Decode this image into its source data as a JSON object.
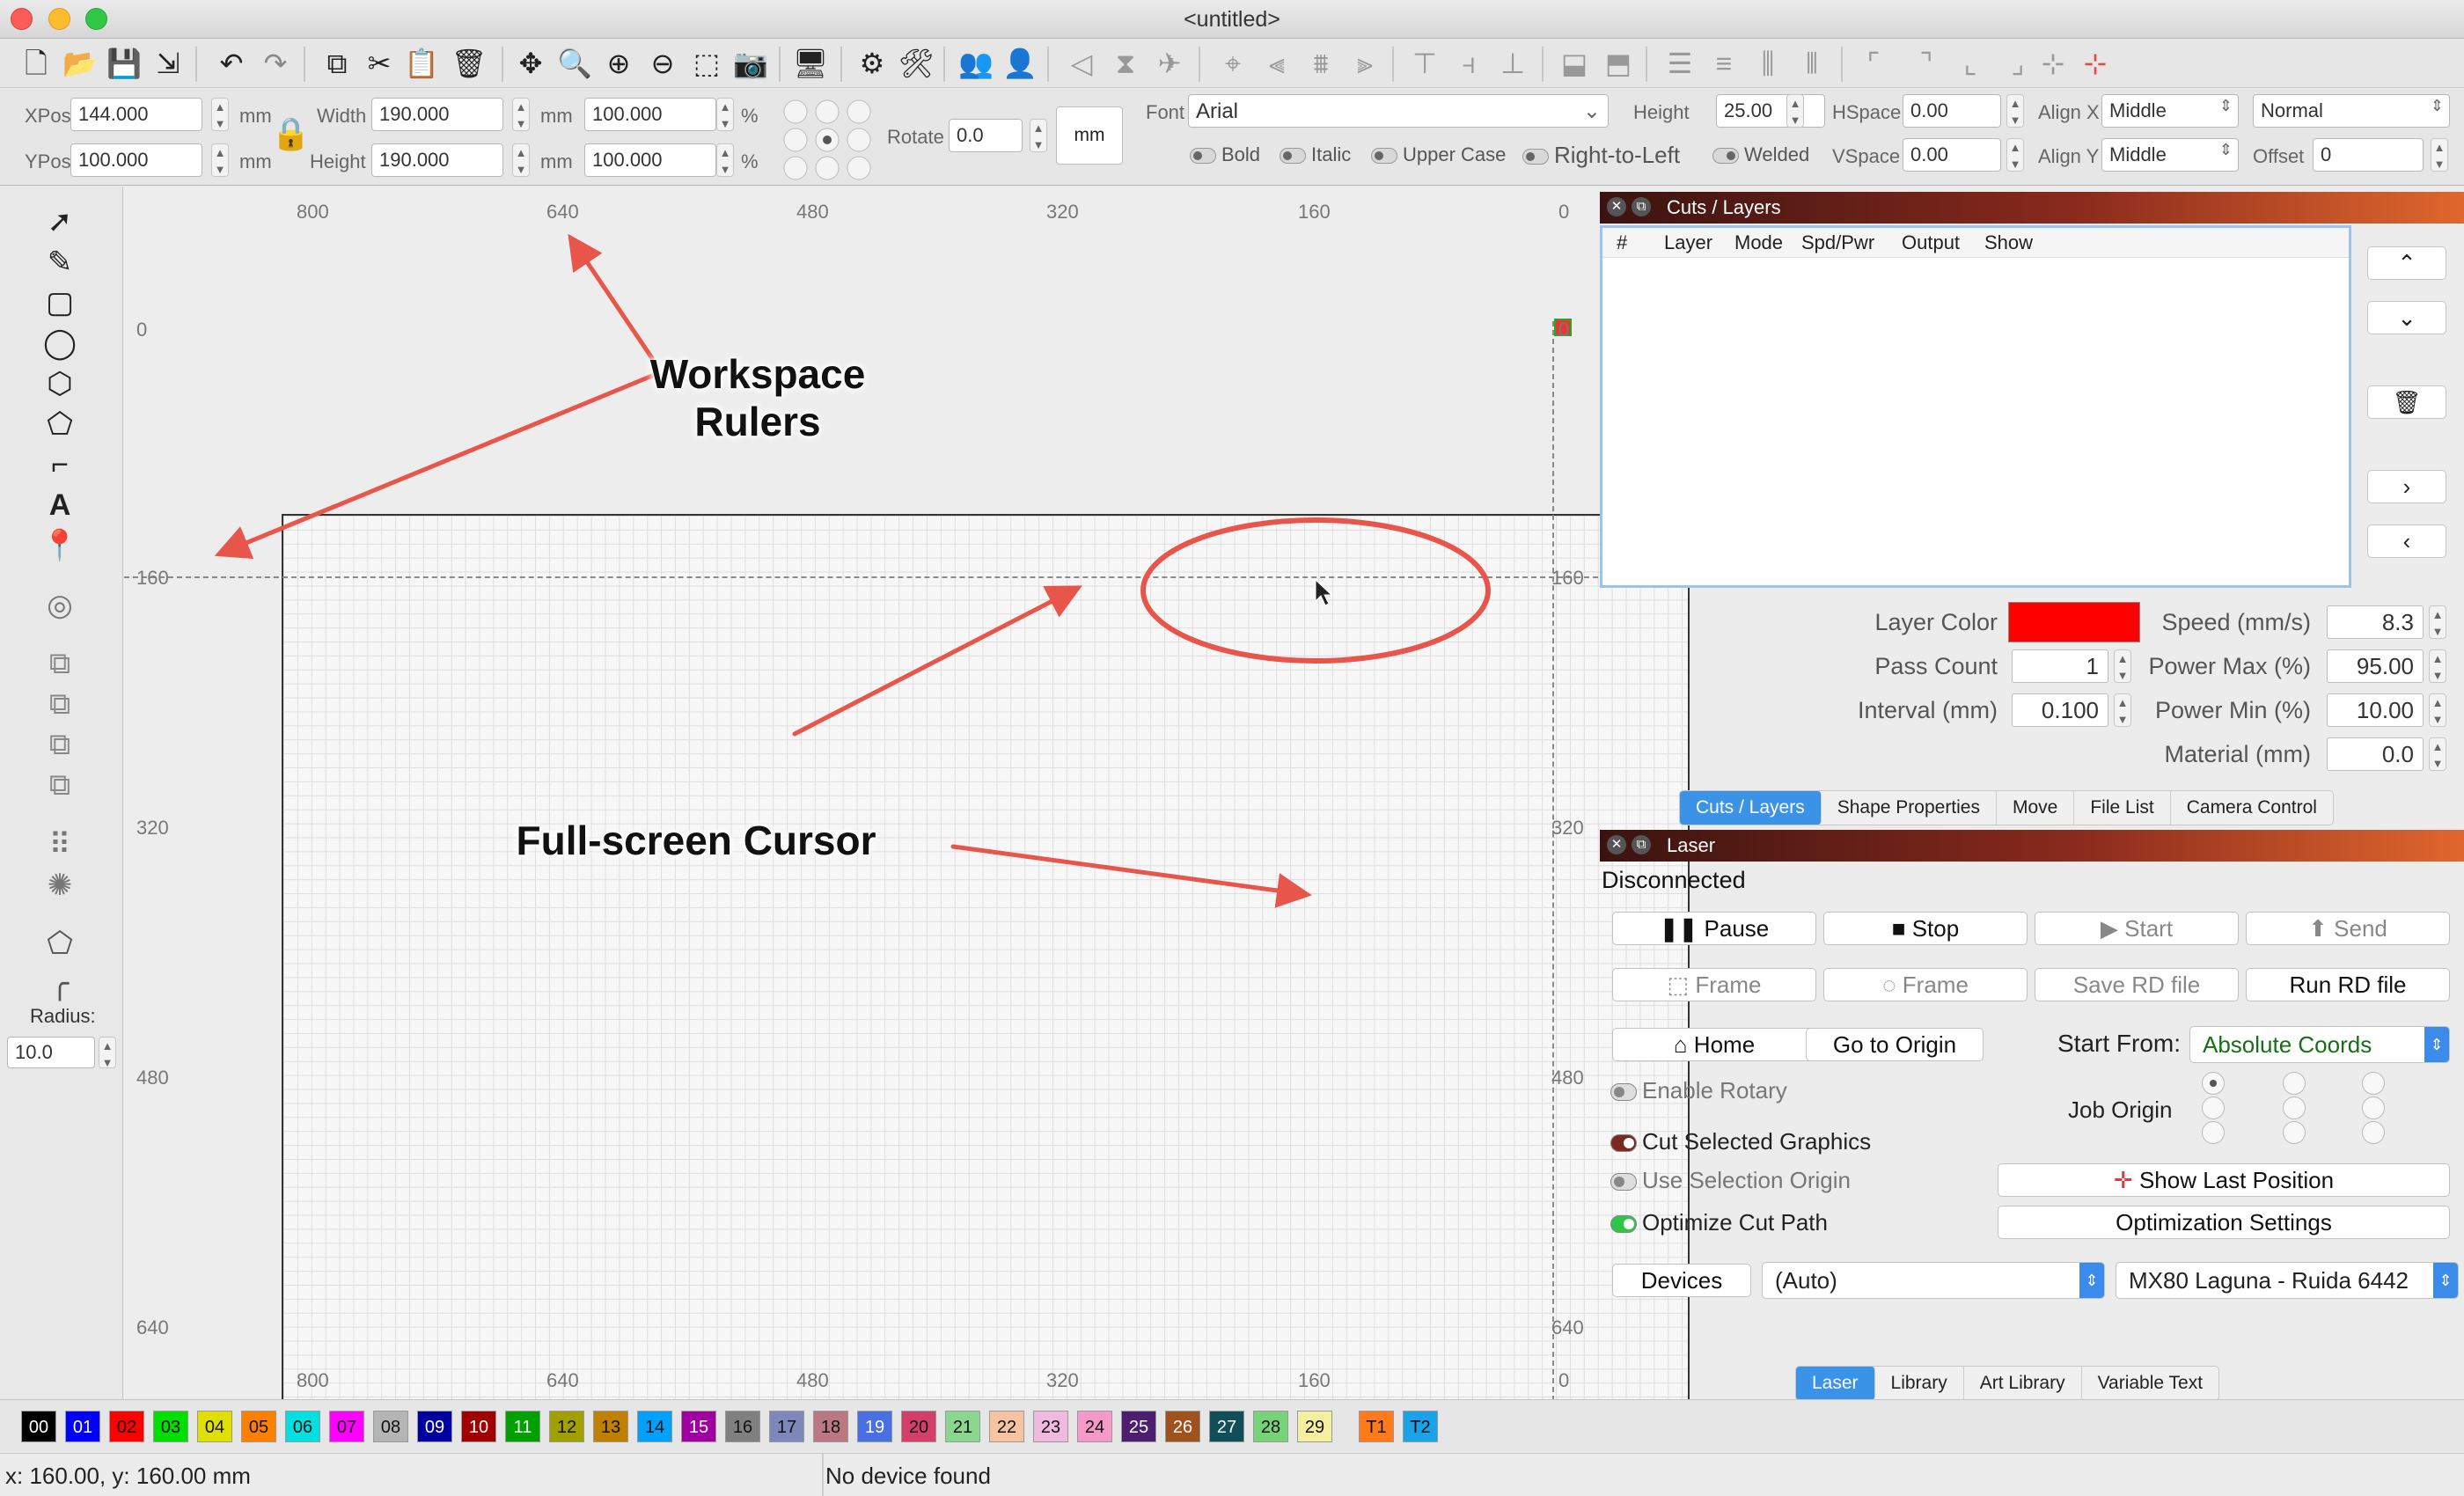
{
  "window": {
    "title": "<untitled>"
  },
  "toolbar2": {
    "xpos_label": "XPos",
    "xpos_value": "144.000",
    "ypos_label": "YPos",
    "ypos_value": "100.000",
    "unit": "mm",
    "width_label": "Width",
    "width_value": "190.000",
    "height_label": "Height",
    "height_value": "190.000",
    "scale_w": "100.000",
    "scale_h": "100.000",
    "percent": "%",
    "rotate_label": "Rotate",
    "rotate_value": "0.0",
    "units_button": "mm",
    "font_label": "Font",
    "font_value": "Arial",
    "fheight_label": "Height",
    "fheight_value": "25.00",
    "hspace_label": "HSpace",
    "hspace_value": "0.00",
    "vspace_label": "VSpace",
    "vspace_value": "0.00",
    "alignx_label": "Align X",
    "alignx_value": "Middle",
    "aligny_label": "Align Y",
    "aligny_value": "Middle",
    "style_value": "Normal",
    "offset_label": "Offset",
    "offset_value": "0",
    "bold": "Bold",
    "italic": "Italic",
    "upper": "Upper Case",
    "rtl": "Right-to-Left",
    "welded": "Welded"
  },
  "toolpanel": {
    "radius_label": "Radius:",
    "radius_value": "10.0"
  },
  "rulers": {
    "top": [
      "800",
      "640",
      "480",
      "320",
      "160",
      "0"
    ],
    "bottom": [
      "800",
      "640",
      "480",
      "320",
      "160",
      "0"
    ],
    "left": [
      "0",
      "160",
      "320",
      "480",
      "640"
    ],
    "right": [
      "0",
      "160",
      "320",
      "480",
      "640"
    ]
  },
  "annotations": {
    "rulers_line1": "Workspace",
    "rulers_line2": "Rulers",
    "cursor": "Full-screen Cursor"
  },
  "cuts": {
    "dock_title": "Cuts / Layers",
    "columns": [
      "#",
      "Layer",
      "Mode",
      "Spd/Pwr",
      "Output",
      "Show"
    ],
    "layer_color_label": "Layer Color",
    "layer_color": "#ff0000",
    "pass_count_label": "Pass Count",
    "pass_count": "1",
    "interval_label": "Interval (mm)",
    "interval": "0.100",
    "speed_label": "Speed (mm/s)",
    "speed": "8.3",
    "power_max_label": "Power Max (%)",
    "power_max": "95.00",
    "power_min_label": "Power Min (%)",
    "power_min": "10.00",
    "material_label": "Material (mm)",
    "material": "0.0",
    "tabs": [
      "Cuts / Layers",
      "Shape Properties",
      "Move",
      "File List",
      "Camera Control"
    ]
  },
  "laser": {
    "dock_title": "Laser",
    "status": "Disconnected",
    "pause": "Pause",
    "stop": "Stop",
    "start": "Start",
    "send": "Send",
    "frame1": "Frame",
    "frame2": "Frame",
    "save_rd": "Save RD file",
    "run_rd": "Run RD file",
    "home": "Home",
    "go_origin": "Go to Origin",
    "start_from_label": "Start From:",
    "start_from": "Absolute Coords",
    "enable_rotary": "Enable Rotary",
    "job_origin": "Job Origin",
    "cut_selected": "Cut Selected Graphics",
    "use_selection_origin": "Use Selection Origin",
    "optimize": "Optimize Cut Path",
    "show_last": "Show Last Position",
    "opt_settings": "Optimization Settings",
    "devices": "Devices",
    "device_port": "(Auto)",
    "device_name": "MX80 Laguna - Ruida 6442",
    "tabs": [
      "Laser",
      "Library",
      "Art Library",
      "Variable Text"
    ]
  },
  "palette": [
    {
      "label": "00",
      "color": "#000000",
      "text": "#ffffff"
    },
    {
      "label": "01",
      "color": "#0000ff",
      "text": "#ffffff"
    },
    {
      "label": "02",
      "color": "#ff0000",
      "text": "#111111"
    },
    {
      "label": "03",
      "color": "#00e000",
      "text": "#111111"
    },
    {
      "label": "04",
      "color": "#e0e000",
      "text": "#111111"
    },
    {
      "label": "05",
      "color": "#ff8000",
      "text": "#111111"
    },
    {
      "label": "06",
      "color": "#00e0e0",
      "text": "#111111"
    },
    {
      "label": "07",
      "color": "#ff00ff",
      "text": "#111111"
    },
    {
      "label": "08",
      "color": "#b4b4b4",
      "text": "#111111"
    },
    {
      "label": "09",
      "color": "#0000a0",
      "text": "#ffffff"
    },
    {
      "label": "10",
      "color": "#a00000",
      "text": "#ffffff"
    },
    {
      "label": "11",
      "color": "#00a000",
      "text": "#ffffff"
    },
    {
      "label": "12",
      "color": "#a0a000",
      "text": "#111111"
    },
    {
      "label": "13",
      "color": "#c08000",
      "text": "#111111"
    },
    {
      "label": "14",
      "color": "#00a0ff",
      "text": "#111111"
    },
    {
      "label": "15",
      "color": "#a000a0",
      "text": "#ffffff"
    },
    {
      "label": "16",
      "color": "#808080",
      "text": "#111111"
    },
    {
      "label": "17",
      "color": "#7d87b9",
      "text": "#111111"
    },
    {
      "label": "18",
      "color": "#bb7784",
      "text": "#111111"
    },
    {
      "label": "19",
      "color": "#4a6fe3",
      "text": "#ffffff"
    },
    {
      "label": "20",
      "color": "#d33f6a",
      "text": "#111111"
    },
    {
      "label": "21",
      "color": "#8cd78f",
      "text": "#111111"
    },
    {
      "label": "22",
      "color": "#f6c4a0",
      "text": "#111111"
    },
    {
      "label": "23",
      "color": "#f0b9e0",
      "text": "#111111"
    },
    {
      "label": "24",
      "color": "#f59ac8",
      "text": "#111111"
    },
    {
      "label": "25",
      "color": "#4b1e70",
      "text": "#ffffff"
    },
    {
      "label": "26",
      "color": "#a0521e",
      "text": "#ffffff"
    },
    {
      "label": "27",
      "color": "#104e5a",
      "text": "#ffffff"
    },
    {
      "label": "28",
      "color": "#78d278",
      "text": "#111111"
    },
    {
      "label": "29",
      "color": "#f5f0a0",
      "text": "#111111"
    },
    {
      "label": "T1",
      "color": "#ff7a1a",
      "text": "#111111"
    },
    {
      "label": "T2",
      "color": "#1aa3e8",
      "text": "#111111"
    }
  ],
  "status": {
    "coords": "x: 160.00, y: 160.00 mm",
    "device": "No device found"
  }
}
